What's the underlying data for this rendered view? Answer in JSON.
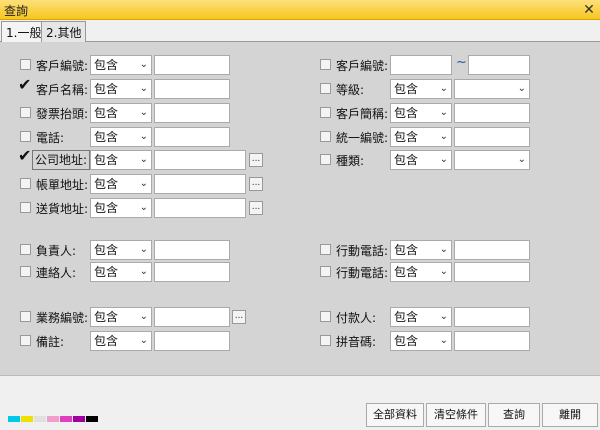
{
  "window": {
    "title": "查詢"
  },
  "tabs": [
    {
      "label": "1.一般"
    },
    {
      "label": "2.其他"
    }
  ],
  "default_op": "包含",
  "left_fields": [
    {
      "label": "客戶編號:",
      "checked": false
    },
    {
      "label": "客戶名稱:",
      "checked": true
    },
    {
      "label": "發票抬頭:",
      "checked": false
    },
    {
      "label": "電話:",
      "checked": false
    },
    {
      "label": "公司地址:",
      "checked": true
    },
    {
      "label": "帳單地址:",
      "checked": false
    },
    {
      "label": "送貨地址:",
      "checked": false
    },
    {
      "label": "負責人:",
      "checked": false
    },
    {
      "label": "連絡人:",
      "checked": false
    },
    {
      "label": "業務編號:",
      "checked": false
    },
    {
      "label": "備註:",
      "checked": false
    }
  ],
  "right_fields": [
    {
      "label": "客戶編號:"
    },
    {
      "label": "等級:"
    },
    {
      "label": "客戶簡稱:"
    },
    {
      "label": "統一編號:"
    },
    {
      "label": "種類:"
    },
    {
      "label": "行動電話:"
    },
    {
      "label": "行動電話:"
    },
    {
      "label": "付款人:"
    },
    {
      "label": "拼音碼:"
    }
  ],
  "range_separator": "~",
  "browse_label": "...",
  "buttons": {
    "all": "全部資料",
    "clear": "清空條件",
    "query": "查詢",
    "leave": "離開"
  },
  "swatch_colors": [
    "#00c8e8",
    "#f0e000",
    "#e0e0e0",
    "#f0a0c8",
    "#e040c0",
    "#a000a0",
    "#000000"
  ]
}
